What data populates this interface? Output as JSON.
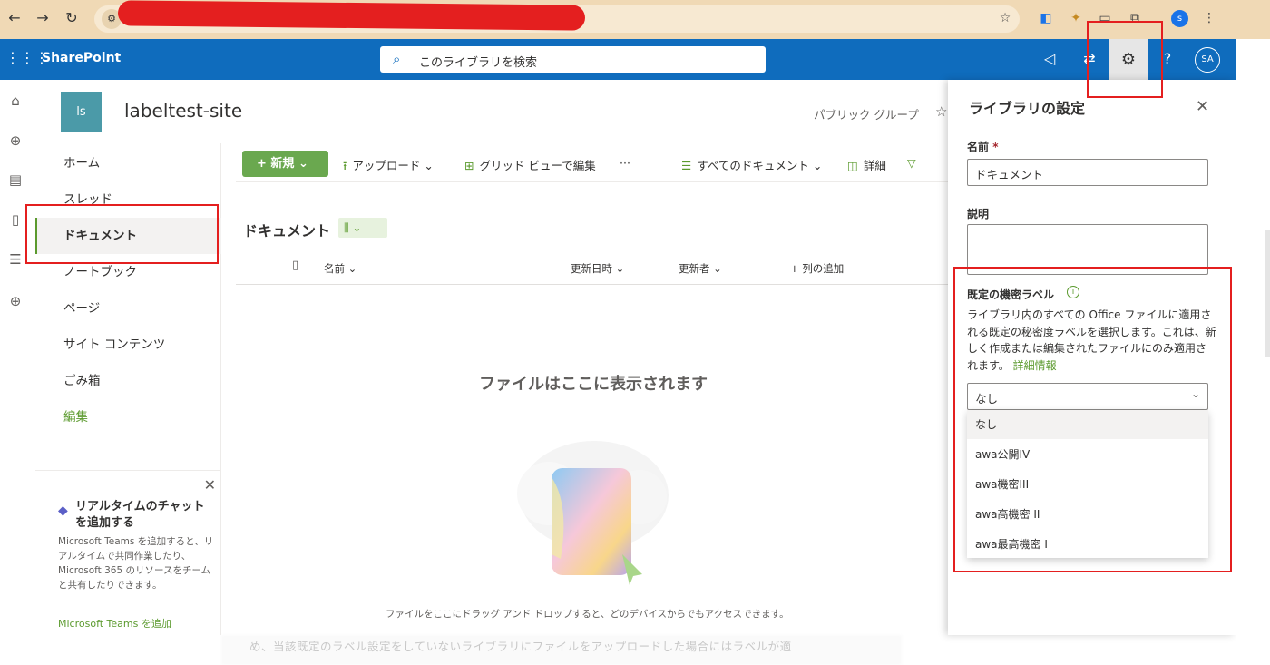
{
  "browser": {
    "back_icon": "arrow-left-icon",
    "forward_icon": "arrow-right-icon",
    "reload_icon": "reload-icon",
    "site_info_icon": "tune-icon",
    "profile_initial": "s"
  },
  "header": {
    "brand": "SharePoint",
    "search_placeholder": "このライブラリを検索",
    "avatar_initials": "SA"
  },
  "site": {
    "logo_text": "ls",
    "title": "labeltest-site",
    "group_type": "パブリック グループ"
  },
  "nav": {
    "items": [
      {
        "label": "ホーム"
      },
      {
        "label": "スレッド"
      },
      {
        "label": "ドキュメント"
      },
      {
        "label": "ノートブック"
      },
      {
        "label": "ページ"
      },
      {
        "label": "サイト コンテンツ"
      },
      {
        "label": "ごみ箱"
      },
      {
        "label": "編集"
      }
    ]
  },
  "teams": {
    "title": "リアルタイムのチャットを追加する",
    "body": "Microsoft Teams を追加すると、リアルタイムで共同作業したり、Microsoft 365 のリソースをチームと共有したりできます。",
    "link": "Microsoft Teams を追加"
  },
  "commands": {
    "new": "新規",
    "upload": "アップロード",
    "grid_edit": "グリッド ビューで編集",
    "more": "···",
    "view": "すべてのドキュメント",
    "details": "詳細"
  },
  "library": {
    "title": "ドキュメント",
    "columns": [
      "名前",
      "更新日時",
      "更新者",
      "列の追加"
    ],
    "empty_title": "ファイルはここに表示されます",
    "empty_desc": "ファイルをここにドラッグ アンド ドロップすると、どのデバイスからでもアクセスできます。",
    "blurred_text": "め、当該既定のラベル設定をしていないライブラリにファイルをアップロードした場合にはラベルが適"
  },
  "panel": {
    "title": "ライブラリの設定",
    "name_label": "名前",
    "required_mark": "*",
    "name_value": "ドキュメント",
    "desc_label": "説明",
    "label_heading": "既定の機密ラベル",
    "label_desc": "ライブラリ内のすべての Office ファイルに適用される既定の秘密度ラベルを選択します。これは、新しく作成または編集されたファイルにのみ適用されます。",
    "learn_more": "詳細情報",
    "selected": "なし",
    "options": [
      "なし",
      "awa公開IV",
      "awa機密III",
      "awa高機密 II",
      "awa最高機密 I"
    ]
  },
  "colors": {
    "suite_bar": "#0f6cbd",
    "accent": "#6aa84f",
    "annotation": "#e41f1f"
  }
}
